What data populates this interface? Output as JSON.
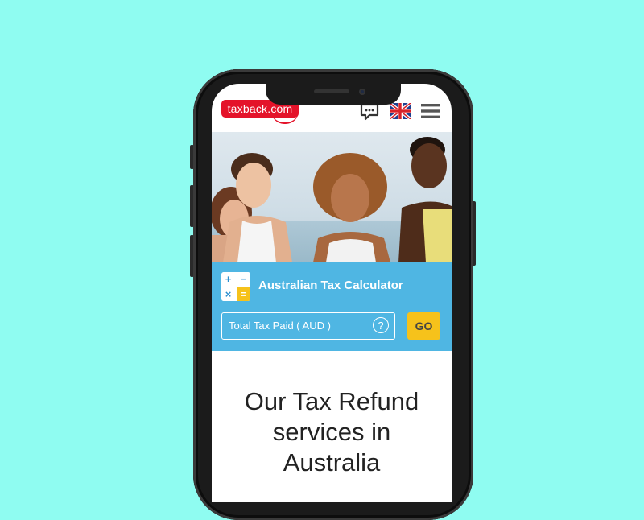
{
  "header": {
    "logo_text": "taxback.com",
    "icons": [
      "chat-icon",
      "uk-flag-icon",
      "hamburger-menu-icon"
    ]
  },
  "calculator": {
    "title": "Australian Tax Calculator",
    "input_placeholder": "Total Tax Paid ( AUD )",
    "help_label": "?",
    "go_label": "GO",
    "icon_symbols": [
      "+",
      "−",
      "×",
      "="
    ]
  },
  "content": {
    "heading_line1": "Our Tax Refund",
    "heading_line2": "services in",
    "heading_line3": "Australia"
  },
  "colors": {
    "background": "#8ffcf1",
    "brand_red": "#e4132a",
    "calc_blue": "#4fb6e3",
    "go_yellow": "#f6c21b"
  }
}
